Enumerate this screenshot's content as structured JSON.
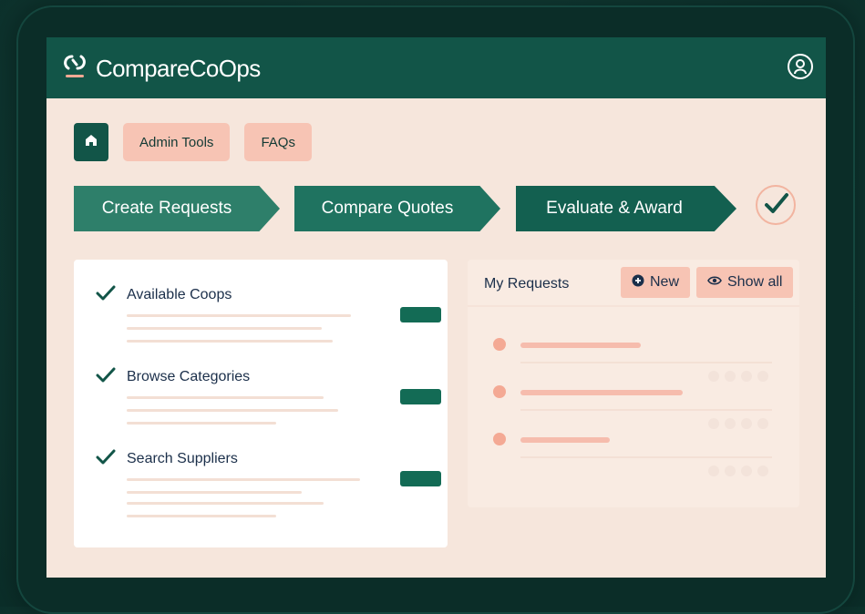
{
  "app": {
    "name": "CompareCoOps"
  },
  "icons": {
    "logo": "link-logo-icon",
    "profile": "user-profile-icon",
    "home": "home-icon",
    "check": "check-icon",
    "new": "plus-circle-icon",
    "show_all": "eye-icon"
  },
  "colors": {
    "primary": "#125548",
    "accent": "#f7c4b4",
    "background": "#f6e6dc"
  },
  "nav": {
    "admin_tools": "Admin Tools",
    "faqs": "FAQs"
  },
  "steps": [
    {
      "label": "Create Requests",
      "color": "#2e7f6a"
    },
    {
      "label": "Compare Quotes",
      "color": "#1f7360"
    },
    {
      "label": "Evaluate & Award",
      "color": "#136050"
    }
  ],
  "tasks": [
    {
      "title": "Available Coops"
    },
    {
      "title": "Browse Categories"
    },
    {
      "title": "Search Suppliers"
    }
  ],
  "requests": {
    "title": "My Requests",
    "new_label": "New",
    "show_all_label": "Show all"
  }
}
